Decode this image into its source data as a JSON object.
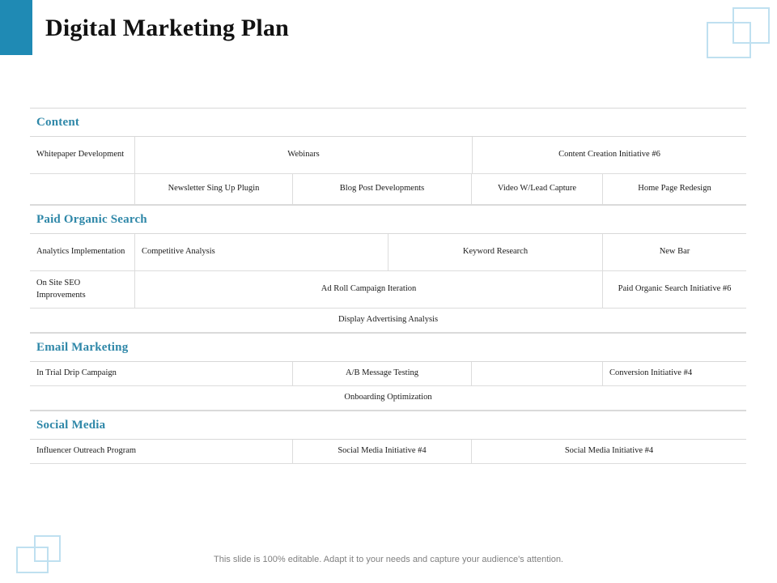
{
  "header": {
    "title": "Digital Marketing Plan",
    "accent_color": "#1f8ab4"
  },
  "theme": {
    "heading_color": "#2e87a8",
    "decoration_color": "#bfe0f0",
    "border_color": "#dcdcdc",
    "footer_text_color": "#808080"
  },
  "sections": [
    {
      "heading": "Content",
      "rows": [
        {
          "cells": [
            {
              "text": "Whitepaper Development",
              "align": "left"
            },
            {
              "text": "Webinars",
              "align": "center"
            },
            {
              "text": "Content Creation Initiative #6",
              "align": "center"
            }
          ]
        },
        {
          "cells": [
            {
              "text": "",
              "align": "left"
            },
            {
              "text": "Newsletter Sing Up Plugin",
              "align": "center"
            },
            {
              "text": "Blog Post Developments",
              "align": "center"
            },
            {
              "text": "Video W/Lead Capture",
              "align": "center"
            },
            {
              "text": "Home Page Redesign",
              "align": "center"
            }
          ]
        }
      ]
    },
    {
      "heading": "Paid Organic Search",
      "rows": [
        {
          "cells": [
            {
              "text": "Analytics Implementation",
              "align": "left"
            },
            {
              "text": "Competitive Analysis",
              "align": "left"
            },
            {
              "text": "Keyword Research",
              "align": "center"
            },
            {
              "text": "New Bar",
              "align": "center"
            }
          ]
        },
        {
          "cells": [
            {
              "text": "On Site SEO Improvements",
              "align": "left"
            },
            {
              "text": "Ad Roll Campaign Iteration",
              "align": "center"
            },
            {
              "text": "Paid Organic Search Initiative #6",
              "align": "center"
            }
          ]
        },
        {
          "cells": [
            {
              "text": "Display Advertising Analysis",
              "align": "center"
            }
          ]
        }
      ]
    },
    {
      "heading": "Email Marketing",
      "rows": [
        {
          "cells": [
            {
              "text": "In Trial Drip Campaign",
              "align": "left"
            },
            {
              "text": "A/B Message Testing",
              "align": "center"
            },
            {
              "text": "",
              "align": "center"
            },
            {
              "text": "Conversion Initiative #4",
              "align": "left"
            }
          ]
        },
        {
          "cells": [
            {
              "text": "Onboarding Optimization",
              "align": "center"
            }
          ]
        }
      ]
    },
    {
      "heading": "Social Media",
      "rows": [
        {
          "cells": [
            {
              "text": "Influencer Outreach Program",
              "align": "left"
            },
            {
              "text": "Social Media Initiative #4",
              "align": "center"
            },
            {
              "text": "Social Media Initiative #4",
              "align": "center"
            }
          ]
        }
      ]
    }
  ],
  "footer": {
    "note": "This slide is 100% editable. Adapt it to your needs and capture your audience's attention."
  }
}
